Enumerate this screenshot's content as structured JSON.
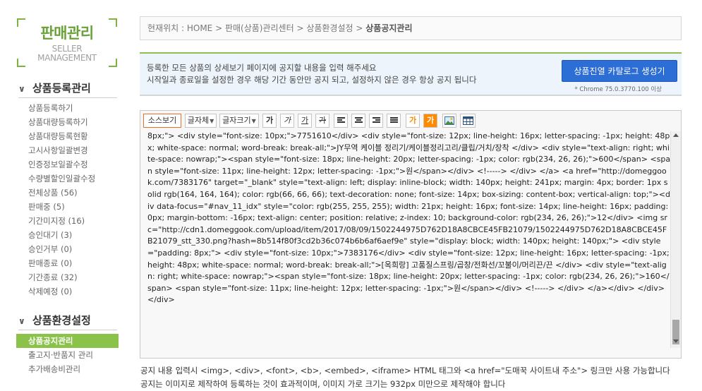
{
  "sidebar": {
    "logo_title": "판매관리",
    "logo_sub1": "SELLER",
    "logo_sub2": "MANAGEMENT",
    "section1_title": "상품등록관리",
    "section1_items": [
      "상품등록하기",
      "상품대량등록하기",
      "상품대량등록현황",
      "고시사항일괄변경",
      "인증정보일괄수정",
      "수량별할인일괄수정",
      "전체상품 (56)",
      "판매중 (5)",
      "기간미지정 (16)",
      "승인대기 (3)",
      "승인거부 (0)",
      "판매종료 (0)",
      "기간종료 (32)",
      "삭제예정 (0)"
    ],
    "section2_title": "상품환경설정",
    "section2_items": [
      "상품공지관리",
      "출고지·반품지 관리",
      "추가배송비관리"
    ]
  },
  "breadcrumb": {
    "label": "현재위치 : ",
    "path": [
      "HOME",
      "판매(상품)관리센터",
      "상품환경설정"
    ],
    "current": "상품공지관리",
    "separator": " > "
  },
  "notice": {
    "line1": "등록한 모든 상품의 상세보기 페이지에 공지할 내용을 입력 해주세요",
    "line2": "시작일과 종료일을 설정한 경우 해당 기간 동안만 공지 되고, 설정하지 않은 경우 항상 공지 됩니다",
    "catalog_button": "상품진열 카탈로그 생성기",
    "chrome_note": "* Chrome 75.0.3770.100 이상"
  },
  "toolbar": {
    "source_view": "소스보기",
    "font_family": "글자체",
    "font_size": "글자크기",
    "bold": "가",
    "italic": "가",
    "underline": "가",
    "strike": "가",
    "font_color": "가",
    "bg_color": "가",
    "align_left_icon": "align-left-icon",
    "align_center_icon": "align-center-icon",
    "align_right_icon": "align-right-icon",
    "justify_icon": "justify-icon",
    "image_icon": "insert-image-icon",
    "table_icon": "insert-table-icon"
  },
  "editor": {
    "source_code": "8px;\"> <div style=\"font-size: 10px;\">7751610</div> <div style=\"font-size: 12px; line-height: 16px; letter-spacing: -1px; height: 48px; white-space: normal; word-break: break-all;\">JY무역 케이블 정리기/케이블정리고리/클립/거치/장착 </div> <div style=\"text-align: right; white-space: nowrap;\"><span style=\"font-size: 18px; line-height: 20px; letter-spacing: -1px; color: rgb(234, 26, 26);\">600</span> <span style=\"font-size: 11px; line-height: 12px; letter-spacing: -1px;\">원</span></div> <!-----> </div> </a> <a href=\"http://domeggook.com/7383176\" target=\"_blank\" style=\"text-align: left; display: inline-block; width: 140px; height: 241px; margin: 4px; border: 1px solid rgb(164, 164, 164); color: rgb(66, 66, 66); text-decoration: none; font-size: 14px; box-sizing: content-box; vertical-align: top;\"><div data-focus=\"#nav_11_idx\" style=\"color: rgb(255, 255, 255); width: 21px; height: 16px; font-size: 14px; line-height: 16px; padding: 0px; margin-bottom: -16px; text-align: center; position: relative; z-index: 10; background-color: rgb(234, 26, 26);\">12</div> <img src=\"http://cdn1.domeggook.com/upload/item/2017/08/09/1502244975D762D18A8CBCE45FB21079/1502244975D762D18A8CBCE45FB21079_stt_330.png?hash=8b514f80f3cd2b36c074b6b6af6aef9e\" style=\"display: block; width: 140px; height: 140px;\"> <div style=\"padding: 8px;\"> <div style=\"font-size: 10px;\">7383176</div> <div style=\"font-size: 12px; line-height: 16px; letter-spacing: -1px; height: 48px; white-space: normal; word-break: break-all;\">[옥희랑] 고품질스프링/곱창/전화선/꼬불이/머리끈/끈 </div> <div style=\"text-align: right; white-space: nowrap;\"><span style=\"font-size: 18px; line-height: 20px; letter-spacing: -1px; color: rgb(234, 26, 26);\">160</span> <span style=\"font-size: 11px; line-height: 12px; letter-spacing: -1px;\">원</span></div> <!-----> </div> </a></div> </div> </div>"
  },
  "footer": {
    "line1": "공지 내용 입력시 <img>, <div>, <font>, <b>, <embed>, <iframe> HTML 태그와 <a href=\"도매꾹 사이트내 주소\"> 링크만 사용 가능합니다",
    "line2": "공지는 이미지로 제작하여 등록하는 것이 효과적이며, 이미지 가로 크기는 932px 미만으로 제작해야 합니다"
  },
  "colors": {
    "accent_green": "#8bc34a",
    "button_blue": "#2d6ed6",
    "price_red": "#ea1a1a"
  }
}
